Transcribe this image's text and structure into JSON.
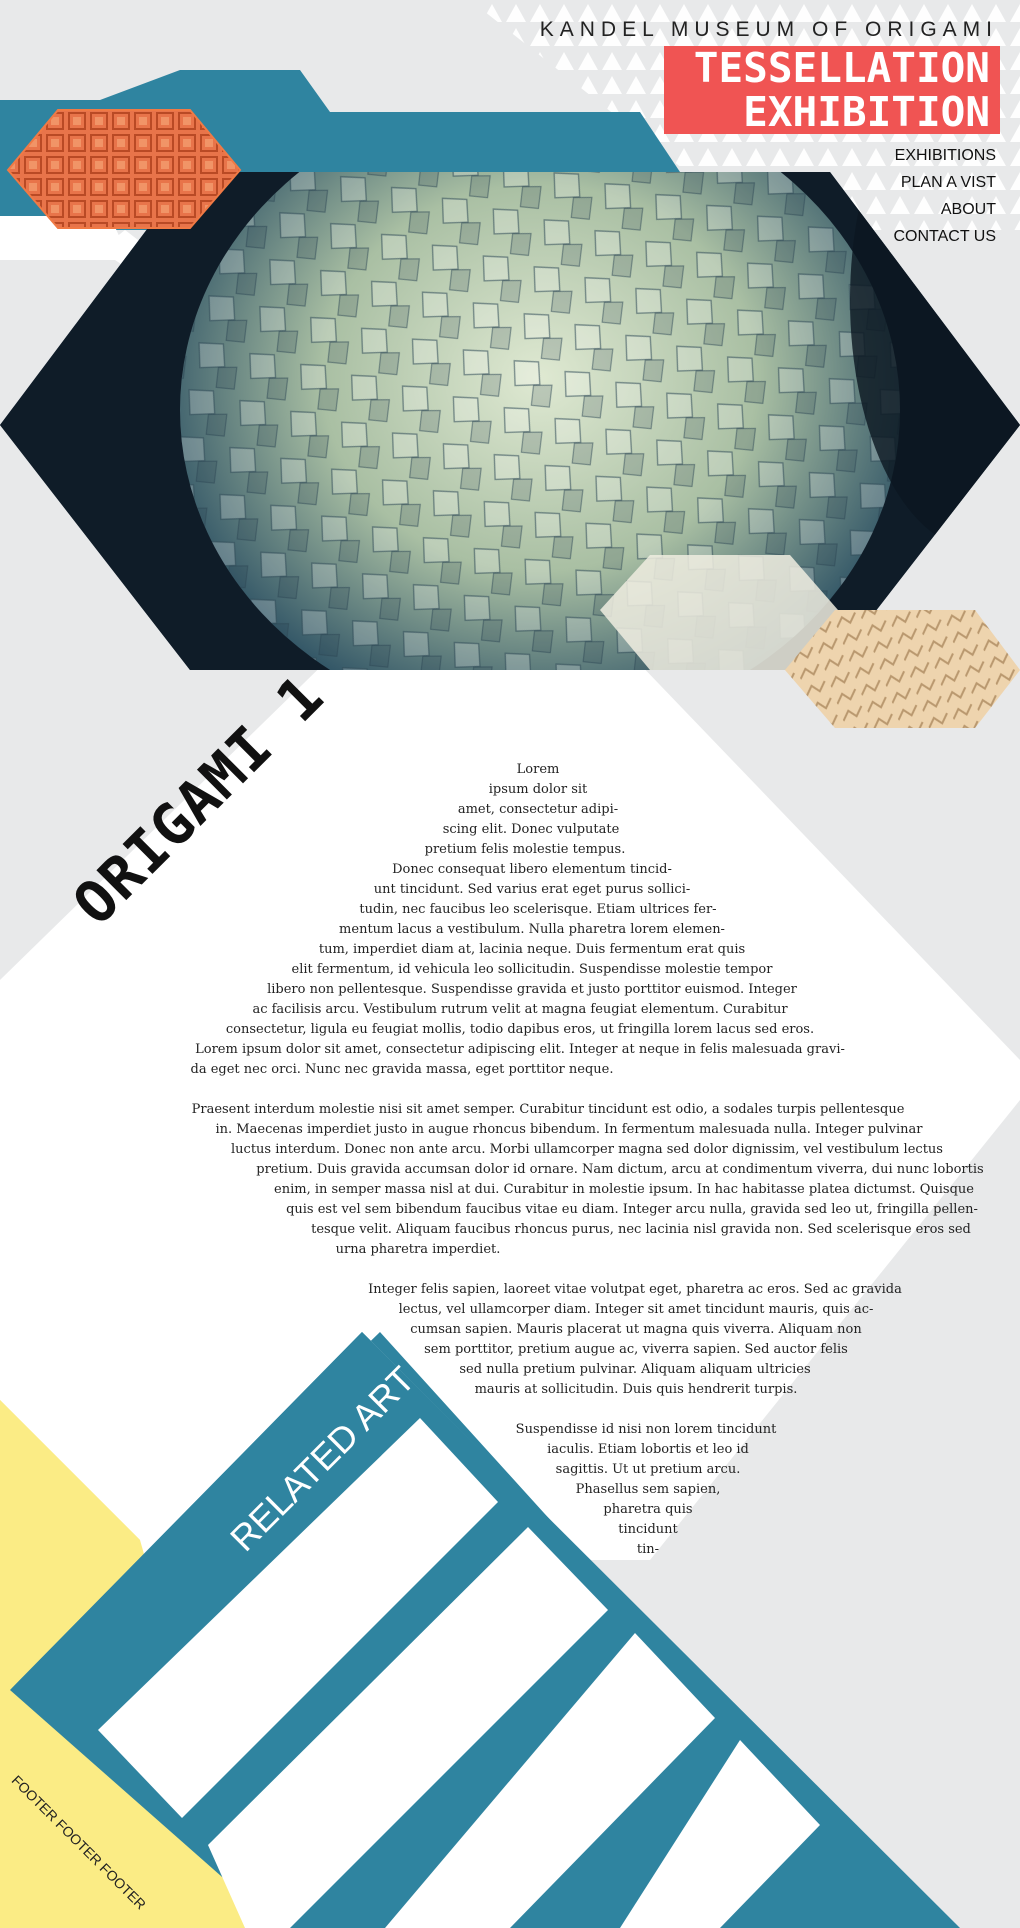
{
  "header": {
    "museum_name": "KANDEL MUSEUM OF ORIGAMI",
    "exhibition_line1": "TESSELLATION",
    "exhibition_line2": "EXHIBITION"
  },
  "nav": [
    "EXHIBITIONS",
    "PLAN A VIST",
    "ABOUT",
    "CONTACT US"
  ],
  "article": {
    "heading": "ORIGAMI 1",
    "para1": [
      "Lorem",
      "ipsum dolor sit",
      "amet, consectetur adipi-",
      "scing elit. Donec vulputate",
      "pretium felis molestie tempus.",
      "Donec consequat libero elementum tincid-",
      "unt tincidunt. Sed varius erat eget purus sollici-",
      "tudin, nec faucibus leo scelerisque. Etiam ultrices fer-",
      "mentum lacus a vestibulum. Nulla pharetra lorem elemen-",
      "tum, imperdiet diam at, lacinia neque. Duis fermentum erat quis",
      "elit fermentum, id vehicula leo sollicitudin. Suspendisse molestie tempor",
      "libero non pellentesque. Suspendisse gravida et justo porttitor euismod. Integer",
      "ac facilisis arcu. Vestibulum rutrum velit at magna feugiat elementum. Curabitur",
      "consectetur, ligula eu feugiat mollis, todio dapibus eros, ut fringilla lorem lacus sed eros.",
      "Lorem ipsum dolor sit amet, consectetur adipiscing elit. Integer at neque in felis malesuada gravi-",
      "da eget nec orci. Nunc nec gravida massa, eget porttitor neque."
    ],
    "para2": [
      "Praesent interdum molestie nisi sit amet semper. Curabitur tincidunt est odio, a sodales turpis pellentesque",
      "in. Maecenas imperdiet justo in augue rhoncus bibendum. In fermentum malesuada nulla. Integer pulvinar",
      "luctus interdum. Donec non ante arcu. Morbi ullamcorper magna sed dolor dignissim, vel vestibulum lectus",
      "pretium. Duis gravida accumsan dolor id ornare. Nam dictum, arcu at condimentum viverra, dui nunc lobortis",
      "enim, in semper massa nisl at dui. Curabitur in molestie ipsum. In hac habitasse platea dictumst. Quisque",
      "quis est vel sem bibendum faucibus vitae eu diam. Integer arcu nulla, gravida sed leo ut, fringilla pellen-",
      "tesque velit. Aliquam faucibus rhoncus purus, nec lacinia nisl gravida non. Sed scelerisque eros sed",
      "urna pharetra imperdiet."
    ],
    "para3": [
      "Integer felis sapien, laoreet vitae volutpat eget, pharetra ac eros. Sed ac gravida",
      "lectus, vel ullamcorper diam. Integer sit amet tincidunt mauris, quis ac-",
      "cumsan sapien. Mauris placerat ut magna quis viverra. Aliquam non",
      "sem porttitor, pretium augue ac, viverra sapien. Sed auctor felis",
      "sed nulla pretium pulvinar. Aliquam aliquam ultricies",
      "mauris at sollicitudin. Duis quis hendrerit turpis."
    ],
    "para4": [
      "Suspendisse id nisi non lorem tincidunt",
      "iaculis. Etiam lobortis et leo id",
      "sagittis. Ut ut pretium arcu.",
      "Phasellus sem sapien,",
      "pharetra quis",
      "tincidunt",
      "tin-"
    ]
  },
  "related": {
    "label": "RELATED ART"
  },
  "footer": {
    "label": "FOOTER FOOTER FOOTER"
  },
  "colors": {
    "accent": "#f05453",
    "teal": "#2f84a0",
    "yellow": "#fbec85",
    "background": "#e8e9ea"
  }
}
